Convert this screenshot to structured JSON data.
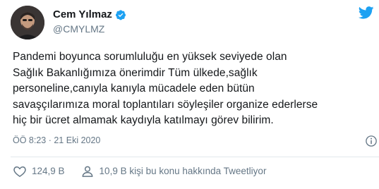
{
  "user": {
    "display_name": "Cem Yılmaz",
    "username": "@CMYLMZ",
    "avatar_icon": "avatar",
    "verified_icon": "verified-badge-icon",
    "verified_color": "#1da1f2"
  },
  "brand": {
    "logo_icon": "twitter-bird-icon",
    "logo_color": "#1da1f2"
  },
  "tweet": {
    "lines": [
      "Pandemi boyunca sorumluluğu en yüksek seviyede olan",
      "Sağlık Bakanlığımıza önerimdir Tüm ülkede,sağlık",
      "personeline,canıyla kanıyla mücadele eden bütün",
      "savaşçılarımıza moral toplantıları söyleşiler organize ederlerse",
      "hiç bir ücret almamak kaydıyla katılmayı görev bilirim."
    ],
    "timestamp": "ÖÖ 8:23 · 21 Eki 2020",
    "info_icon": "info-icon"
  },
  "actions": {
    "like_count": "124,9 B",
    "like_icon": "heart-icon",
    "talking_text": "10,9 B kişi bu konu hakkında Tweetliyor",
    "talking_icon": "person-icon"
  },
  "colors": {
    "text": "#14171a",
    "secondary": "#657786",
    "divider": "#e1e8ed"
  }
}
